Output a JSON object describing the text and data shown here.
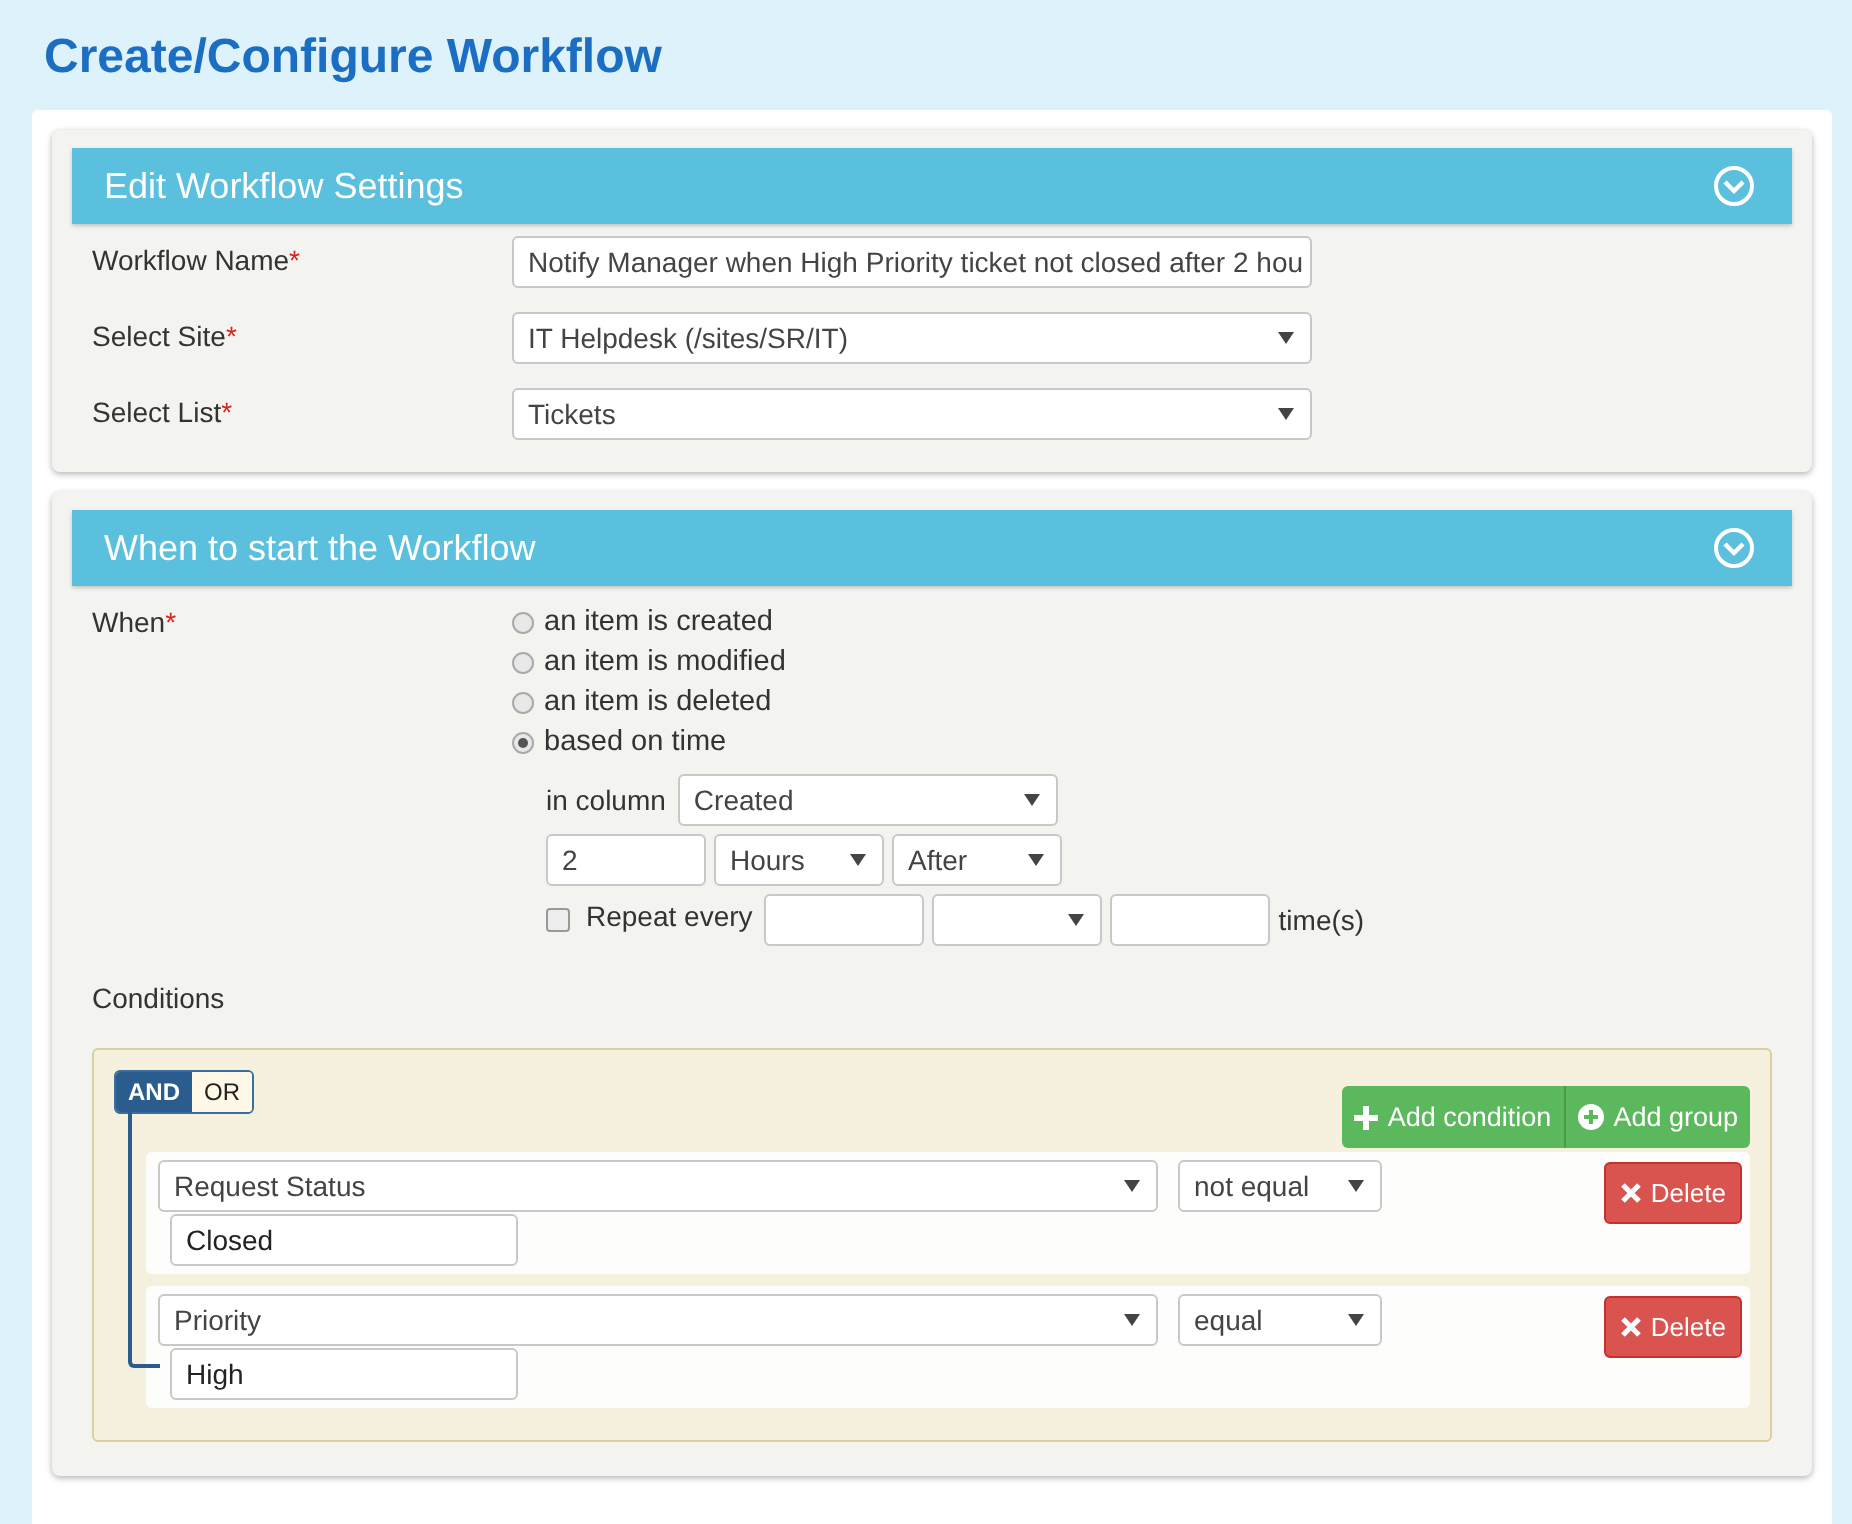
{
  "page_title": "Create/Configure Workflow",
  "settings": {
    "title": "Edit Workflow Settings",
    "expanded": true,
    "fields": [
      {
        "kind": "text",
        "label": "Workflow Name",
        "required_mark": "*",
        "value": "Notify Manager when High Priority ticket not closed after 2 hou"
      },
      {
        "kind": "select",
        "label": "Select Site",
        "required_mark": "*",
        "value": "IT Helpdesk (/sites/SR/IT)"
      },
      {
        "kind": "select",
        "label": "Select List",
        "required_mark": "*",
        "value": "Tickets"
      }
    ]
  },
  "trigger": {
    "title": "When to start the Workflow",
    "expanded": true,
    "label": "When",
    "required_mark": "*",
    "options": [
      {
        "label": "an item is created",
        "selected": false
      },
      {
        "label": "an item is modified",
        "selected": false
      },
      {
        "label": "an item is deleted",
        "selected": false
      },
      {
        "label": "based on time",
        "selected": true
      }
    ],
    "column_label": "in column",
    "column_value": "Created",
    "offset_value": "2",
    "unit_value": "Hours",
    "direction_value": "After",
    "repeat": {
      "label": "Repeat every",
      "checked": false,
      "suffix": "time(s)"
    },
    "conditions_label": "Conditions",
    "logic": [
      {
        "label": "AND",
        "selected": true
      },
      {
        "label": "OR",
        "selected": false
      }
    ],
    "add_condition": "Add condition",
    "add_group": "Add group",
    "rules": [
      {
        "field": "Request Status",
        "operator": "not equal",
        "value": "Closed",
        "delete": "Delete"
      },
      {
        "field": "Priority",
        "operator": "equal",
        "value": "High",
        "delete": "Delete"
      }
    ]
  }
}
